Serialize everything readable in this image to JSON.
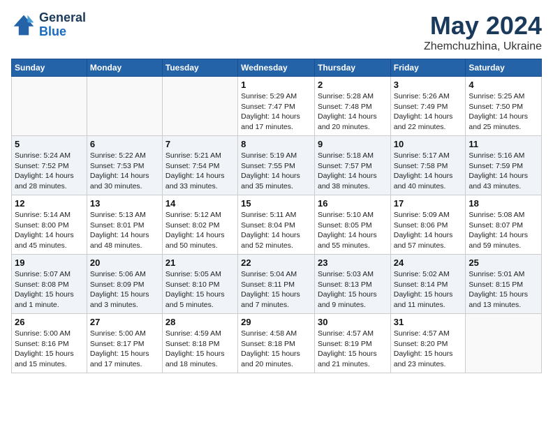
{
  "header": {
    "logo_line1": "General",
    "logo_line2": "Blue",
    "month": "May 2024",
    "location": "Zhemchuzhina, Ukraine"
  },
  "weekdays": [
    "Sunday",
    "Monday",
    "Tuesday",
    "Wednesday",
    "Thursday",
    "Friday",
    "Saturday"
  ],
  "weeks": [
    [
      {
        "day": "",
        "info": ""
      },
      {
        "day": "",
        "info": ""
      },
      {
        "day": "",
        "info": ""
      },
      {
        "day": "1",
        "info": "Sunrise: 5:29 AM\nSunset: 7:47 PM\nDaylight: 14 hours\nand 17 minutes."
      },
      {
        "day": "2",
        "info": "Sunrise: 5:28 AM\nSunset: 7:48 PM\nDaylight: 14 hours\nand 20 minutes."
      },
      {
        "day": "3",
        "info": "Sunrise: 5:26 AM\nSunset: 7:49 PM\nDaylight: 14 hours\nand 22 minutes."
      },
      {
        "day": "4",
        "info": "Sunrise: 5:25 AM\nSunset: 7:50 PM\nDaylight: 14 hours\nand 25 minutes."
      }
    ],
    [
      {
        "day": "5",
        "info": "Sunrise: 5:24 AM\nSunset: 7:52 PM\nDaylight: 14 hours\nand 28 minutes."
      },
      {
        "day": "6",
        "info": "Sunrise: 5:22 AM\nSunset: 7:53 PM\nDaylight: 14 hours\nand 30 minutes."
      },
      {
        "day": "7",
        "info": "Sunrise: 5:21 AM\nSunset: 7:54 PM\nDaylight: 14 hours\nand 33 minutes."
      },
      {
        "day": "8",
        "info": "Sunrise: 5:19 AM\nSunset: 7:55 PM\nDaylight: 14 hours\nand 35 minutes."
      },
      {
        "day": "9",
        "info": "Sunrise: 5:18 AM\nSunset: 7:57 PM\nDaylight: 14 hours\nand 38 minutes."
      },
      {
        "day": "10",
        "info": "Sunrise: 5:17 AM\nSunset: 7:58 PM\nDaylight: 14 hours\nand 40 minutes."
      },
      {
        "day": "11",
        "info": "Sunrise: 5:16 AM\nSunset: 7:59 PM\nDaylight: 14 hours\nand 43 minutes."
      }
    ],
    [
      {
        "day": "12",
        "info": "Sunrise: 5:14 AM\nSunset: 8:00 PM\nDaylight: 14 hours\nand 45 minutes."
      },
      {
        "day": "13",
        "info": "Sunrise: 5:13 AM\nSunset: 8:01 PM\nDaylight: 14 hours\nand 48 minutes."
      },
      {
        "day": "14",
        "info": "Sunrise: 5:12 AM\nSunset: 8:02 PM\nDaylight: 14 hours\nand 50 minutes."
      },
      {
        "day": "15",
        "info": "Sunrise: 5:11 AM\nSunset: 8:04 PM\nDaylight: 14 hours\nand 52 minutes."
      },
      {
        "day": "16",
        "info": "Sunrise: 5:10 AM\nSunset: 8:05 PM\nDaylight: 14 hours\nand 55 minutes."
      },
      {
        "day": "17",
        "info": "Sunrise: 5:09 AM\nSunset: 8:06 PM\nDaylight: 14 hours\nand 57 minutes."
      },
      {
        "day": "18",
        "info": "Sunrise: 5:08 AM\nSunset: 8:07 PM\nDaylight: 14 hours\nand 59 minutes."
      }
    ],
    [
      {
        "day": "19",
        "info": "Sunrise: 5:07 AM\nSunset: 8:08 PM\nDaylight: 15 hours\nand 1 minute."
      },
      {
        "day": "20",
        "info": "Sunrise: 5:06 AM\nSunset: 8:09 PM\nDaylight: 15 hours\nand 3 minutes."
      },
      {
        "day": "21",
        "info": "Sunrise: 5:05 AM\nSunset: 8:10 PM\nDaylight: 15 hours\nand 5 minutes."
      },
      {
        "day": "22",
        "info": "Sunrise: 5:04 AM\nSunset: 8:11 PM\nDaylight: 15 hours\nand 7 minutes."
      },
      {
        "day": "23",
        "info": "Sunrise: 5:03 AM\nSunset: 8:13 PM\nDaylight: 15 hours\nand 9 minutes."
      },
      {
        "day": "24",
        "info": "Sunrise: 5:02 AM\nSunset: 8:14 PM\nDaylight: 15 hours\nand 11 minutes."
      },
      {
        "day": "25",
        "info": "Sunrise: 5:01 AM\nSunset: 8:15 PM\nDaylight: 15 hours\nand 13 minutes."
      }
    ],
    [
      {
        "day": "26",
        "info": "Sunrise: 5:00 AM\nSunset: 8:16 PM\nDaylight: 15 hours\nand 15 minutes."
      },
      {
        "day": "27",
        "info": "Sunrise: 5:00 AM\nSunset: 8:17 PM\nDaylight: 15 hours\nand 17 minutes."
      },
      {
        "day": "28",
        "info": "Sunrise: 4:59 AM\nSunset: 8:18 PM\nDaylight: 15 hours\nand 18 minutes."
      },
      {
        "day": "29",
        "info": "Sunrise: 4:58 AM\nSunset: 8:18 PM\nDaylight: 15 hours\nand 20 minutes."
      },
      {
        "day": "30",
        "info": "Sunrise: 4:57 AM\nSunset: 8:19 PM\nDaylight: 15 hours\nand 21 minutes."
      },
      {
        "day": "31",
        "info": "Sunrise: 4:57 AM\nSunset: 8:20 PM\nDaylight: 15 hours\nand 23 minutes."
      },
      {
        "day": "",
        "info": ""
      }
    ]
  ]
}
